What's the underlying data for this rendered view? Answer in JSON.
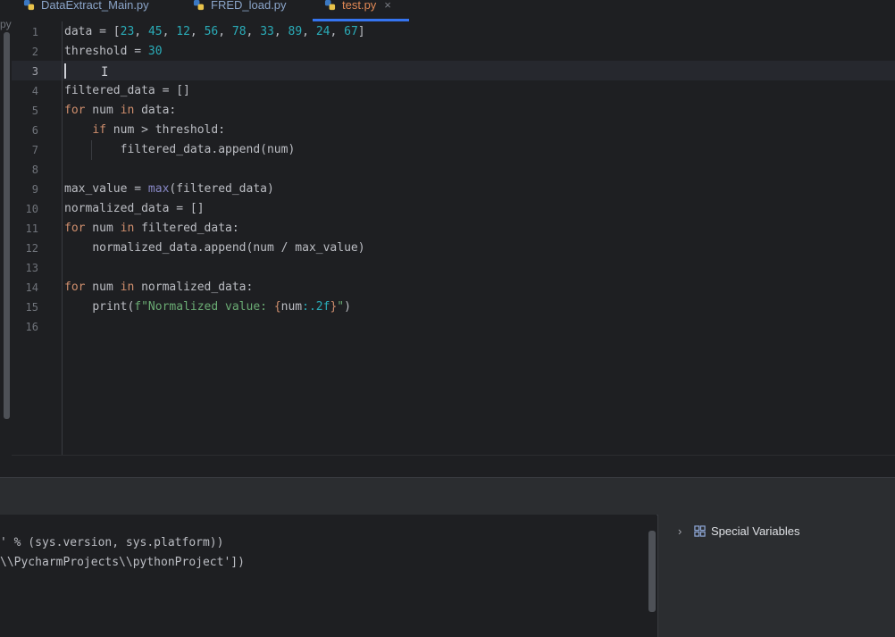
{
  "tabs": [
    {
      "label": "DataExtract_Main.py",
      "active": false
    },
    {
      "label": "FRED_load.py",
      "active": false
    },
    {
      "label": "test.py",
      "active": true,
      "close": "×"
    }
  ],
  "left_strip_fragment": "py",
  "editor": {
    "current_line": 3,
    "line_numbers": [
      "1",
      "2",
      "3",
      "4",
      "5",
      "6",
      "7",
      "8",
      "9",
      "10",
      "11",
      "12",
      "13",
      "14",
      "15",
      "16"
    ],
    "lines": {
      "l1": {
        "a": "data = [",
        "n1": "23",
        "c1": ", ",
        "n2": "45",
        "c2": ", ",
        "n3": "12",
        "c3": ", ",
        "n4": "56",
        "c4": ", ",
        "n5": "78",
        "c5": ", ",
        "n6": "33",
        "c6": ", ",
        "n7": "89",
        "c7": ", ",
        "n8": "24",
        "c8": ", ",
        "n9": "67",
        "z": "]"
      },
      "l2": {
        "a": "threshold = ",
        "n": "30"
      },
      "l4": {
        "a": "filtered_data = []"
      },
      "l5": {
        "kw1": "for",
        "a": " num ",
        "kw2": "in",
        "b": " data:"
      },
      "l6": {
        "ind": "    ",
        "kw1": "if",
        "a": " num > threshold:"
      },
      "l7": {
        "ind": "        ",
        "a": "filtered_data.append(num)"
      },
      "l9": {
        "a": "max_value = ",
        "bi": "max",
        "b": "(filtered_data)"
      },
      "l10": {
        "a": "normalized_data = []"
      },
      "l11": {
        "kw1": "for",
        "a": " num ",
        "kw2": "in",
        "b": " filtered_data:"
      },
      "l12": {
        "ind": "    ",
        "a": "normalized_data.append(num / max_value)"
      },
      "l14": {
        "kw1": "for",
        "a": " num ",
        "kw2": "in",
        "b": " normalized_data:"
      },
      "l15": {
        "ind": "    ",
        "a": "print(",
        "s1": "f\"Normalized value: ",
        "f1": "{",
        "v": "num",
        "f2": ":.2f",
        "f3": "}",
        "s2": "\"",
        "b": ")"
      }
    }
  },
  "console": {
    "lines": [
      "' % (sys.version, sys.platform))",
      "\\\\PycharmProjects\\\\pythonProject'])"
    ]
  },
  "variables": {
    "special_label": "Special Variables",
    "chevron": "›"
  },
  "colors": {
    "keyword": "#cf8e6d",
    "number": "#2aacb8",
    "string": "#6aab73",
    "builtin": "#8888c6",
    "accent": "#3574f0",
    "active_tab": "#e08855"
  }
}
